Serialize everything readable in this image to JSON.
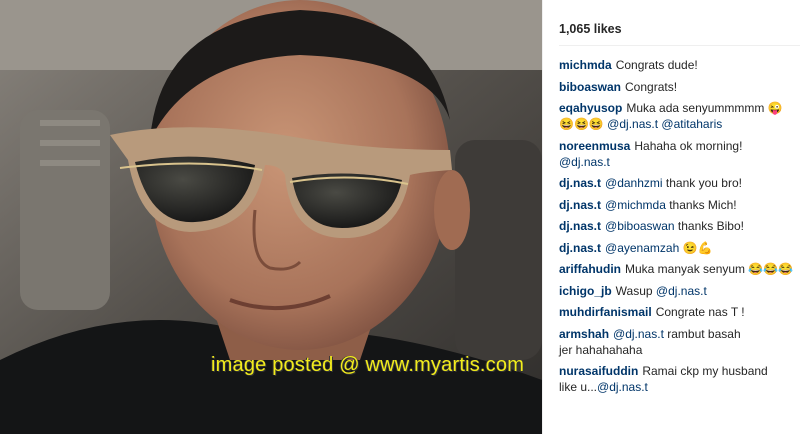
{
  "post": {
    "likes": "1,065 likes",
    "watermark": "image posted @ www.myartis.com"
  },
  "comments": [
    {
      "user": "michmda",
      "lines": [
        [
          {
            "t": "Congrats dude!"
          }
        ]
      ]
    },
    {
      "user": "biboaswan",
      "lines": [
        [
          {
            "t": "Congrats!"
          }
        ]
      ]
    },
    {
      "user": "eqahyusop",
      "lines": [
        [
          {
            "t": "Muka ada senyummmmm 😜"
          }
        ],
        [
          {
            "t": "😆😆😆 "
          },
          {
            "t": "@dj.nas.t",
            "m": true
          },
          {
            "t": " "
          },
          {
            "t": "@atitaharis",
            "m": true
          }
        ]
      ]
    },
    {
      "user": "noreenmusa",
      "lines": [
        [
          {
            "t": "Hahaha ok morning!"
          }
        ],
        [
          {
            "t": "@dj.nas.t",
            "m": true
          }
        ]
      ]
    },
    {
      "user": "dj.nas.t",
      "lines": [
        [
          {
            "t": "@danhzmi",
            "m": true
          },
          {
            "t": " thank you bro!"
          }
        ]
      ]
    },
    {
      "user": "dj.nas.t",
      "lines": [
        [
          {
            "t": "@michmda",
            "m": true
          },
          {
            "t": " thanks Mich!"
          }
        ]
      ]
    },
    {
      "user": "dj.nas.t",
      "lines": [
        [
          {
            "t": "@biboaswan",
            "m": true
          },
          {
            "t": " thanks Bibo!"
          }
        ]
      ]
    },
    {
      "user": "dj.nas.t",
      "lines": [
        [
          {
            "t": "@ayenamzah",
            "m": true
          },
          {
            "t": " 😉💪"
          }
        ]
      ]
    },
    {
      "user": "ariffahudin",
      "lines": [
        [
          {
            "t": "Muka manyak senyum 😂😂😂"
          }
        ]
      ]
    },
    {
      "user": "ichigo_jb",
      "lines": [
        [
          {
            "t": "Wasup "
          },
          {
            "t": "@dj.nas.t",
            "m": true
          }
        ]
      ]
    },
    {
      "user": "muhdirfanismail",
      "lines": [
        [
          {
            "t": "Congrate nas T !"
          }
        ]
      ]
    },
    {
      "user": "armshah",
      "lines": [
        [
          {
            "t": "@dj.nas.t",
            "m": true
          },
          {
            "t": " rambut basah"
          }
        ],
        [
          {
            "t": "jer hahahahaha"
          }
        ]
      ]
    },
    {
      "user": "nurasaifuddin",
      "lines": [
        [
          {
            "t": "Ramai ckp my husband"
          }
        ],
        [
          {
            "t": "like u..."
          },
          {
            "t": "@dj.nas.t",
            "m": true
          }
        ]
      ]
    }
  ],
  "colors": {
    "username": "#003569",
    "text": "#262626",
    "watermark": "#f2ec1c"
  }
}
